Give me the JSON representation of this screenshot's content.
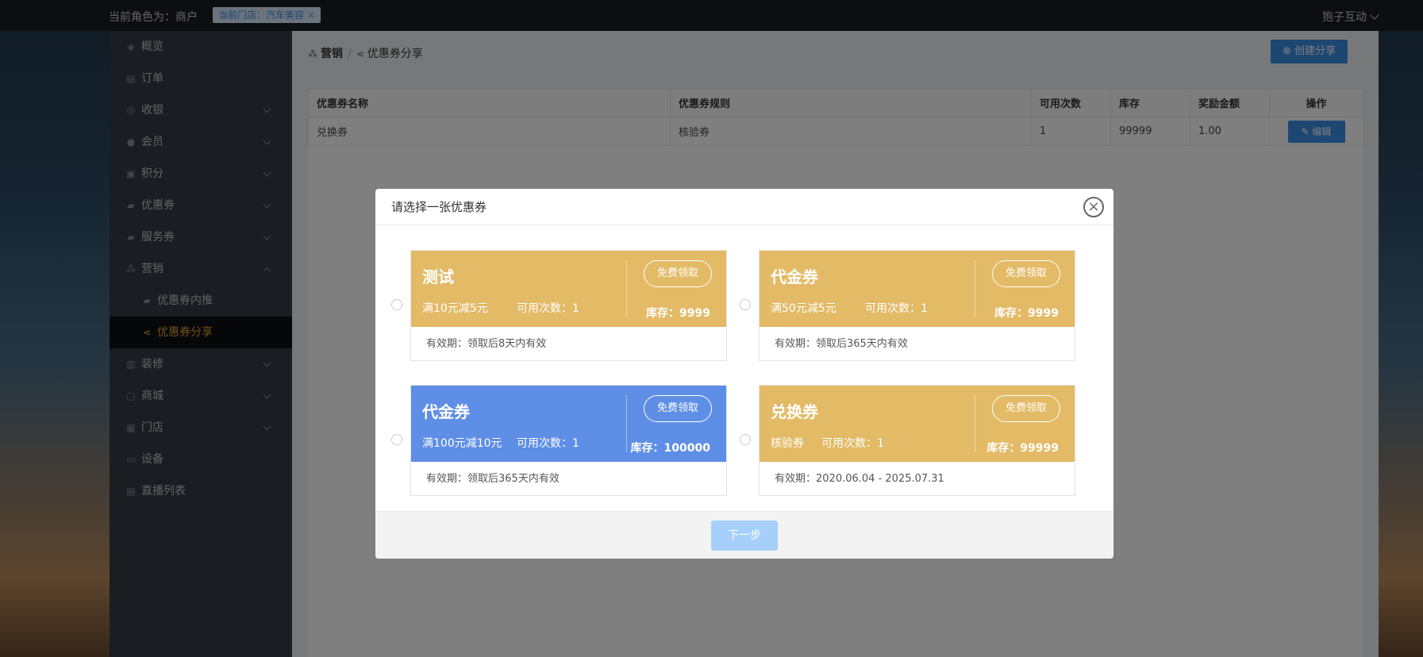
{
  "topbar": {
    "role": "当前角色为：商户",
    "store_tag": "当前门店：汽车美容",
    "store_tag_close": "×",
    "user": "狍子互动"
  },
  "sidebar": {
    "items": [
      {
        "label": "概览",
        "icon": "dashboard-icon"
      },
      {
        "label": "订单",
        "icon": "order-icon"
      },
      {
        "label": "收银",
        "icon": "cashier-icon"
      },
      {
        "label": "会员",
        "icon": "member-icon"
      },
      {
        "label": "积分",
        "icon": "points-icon"
      },
      {
        "label": "优惠券",
        "icon": "coupon-icon"
      },
      {
        "label": "服务券",
        "icon": "service-coupon-icon"
      },
      {
        "label": "营销",
        "icon": "marketing-icon"
      },
      {
        "label": "优惠券内推",
        "icon": "coupon-icon"
      },
      {
        "label": "优惠券分享",
        "icon": "share-icon"
      },
      {
        "label": "装修",
        "icon": "decorate-icon"
      },
      {
        "label": "商城",
        "icon": "mall-icon"
      },
      {
        "label": "门店",
        "icon": "store-icon"
      },
      {
        "label": "设备",
        "icon": "device-icon"
      },
      {
        "label": "直播列表",
        "icon": "live-icon"
      }
    ]
  },
  "breadcrumb": {
    "parent": "营销",
    "separator": "/",
    "current": "优惠券分享"
  },
  "create_button": "创建分享",
  "table": {
    "headers": [
      "优惠券名称",
      "优惠券规则",
      "可用次数",
      "库存",
      "奖励金额",
      "操作"
    ],
    "rows": [
      {
        "name": "兑换券",
        "rule": "核验券",
        "uses": "1",
        "stock": "99999",
        "reward": "1.00",
        "action": "编辑"
      }
    ]
  },
  "modal": {
    "title": "请选择一张优惠券",
    "close": "×",
    "next_button": "下一步",
    "coupons": [
      {
        "name": "测试",
        "rule": "满10元减5元",
        "uses": "可用次数：1",
        "claim": "免费领取",
        "stock": "库存：9999",
        "validity": "有效期：领取后8天内有效",
        "color": "#e3ba66"
      },
      {
        "name": "代金券",
        "rule": "满50元减5元",
        "uses": "可用次数：1",
        "claim": "免费领取",
        "stock": "库存：9999",
        "validity": "有效期：领取后365天内有效",
        "color": "#e3ba66"
      },
      {
        "name": "代金券",
        "rule": "满100元减10元",
        "uses": "可用次数：1",
        "claim": "免费领取",
        "stock": "库存：100000",
        "validity": "有效期：领取后365天内有效",
        "color": "#5e8ee6"
      },
      {
        "name": "兑换券",
        "rule": "核验券",
        "uses": "可用次数：1",
        "claim": "免费领取",
        "stock": "库存：99999",
        "validity": "有效期：2020.06.04 - 2025.07.31",
        "color": "#e3ba66"
      }
    ]
  },
  "colors": {
    "primary": "#3a8ee6",
    "active_nav": "#e8a33d",
    "coupon_gold": "#e3ba66",
    "coupon_blue": "#5e8ee6"
  }
}
